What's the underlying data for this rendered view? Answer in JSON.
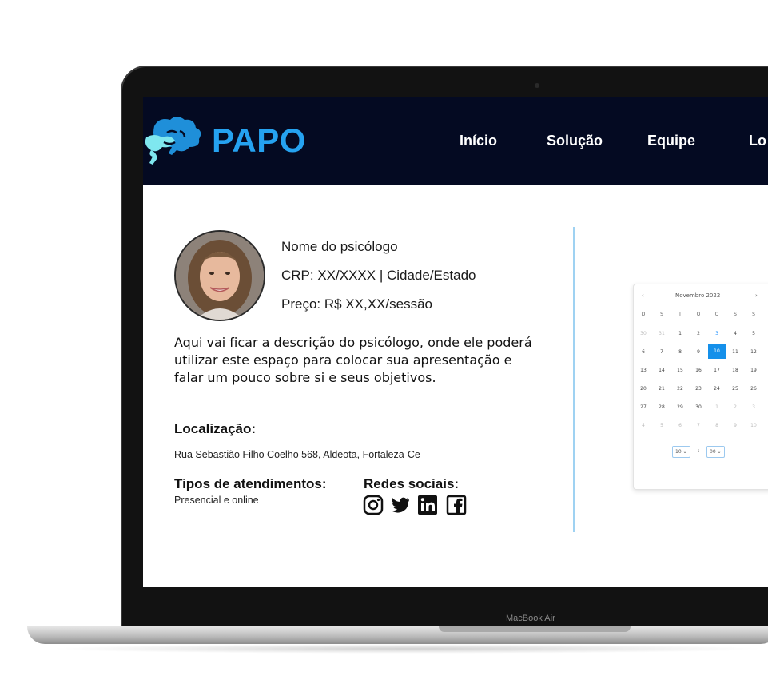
{
  "device": {
    "label": "MacBook Air"
  },
  "nav": {
    "brand": "PAPO",
    "links": [
      "Início",
      "Solução",
      "Equipe",
      "Lo"
    ]
  },
  "profile": {
    "name": "Nome do psicólogo",
    "crp": "CRP: XX/XXXX | Cidade/Estado",
    "price": "Preço: R$ XX,XX/sessão",
    "description": "Aqui vai ficar a descrição do psicólogo, onde ele poderá utilizar este espaço para colocar sua apresentação e falar um pouco sobre si e seus objetivos.",
    "location_label": "Localização:",
    "address": "Rua Sebastião Filho Coelho 568, Aldeota, Fortaleza-Ce",
    "service_types_label": "Tipos de atendimentos:",
    "service_types": "Presencial e online",
    "social_label": "Redes sociais:",
    "social_icons": [
      "instagram-icon",
      "twitter-icon",
      "linkedin-icon",
      "facebook-icon"
    ]
  },
  "calendar": {
    "prev": "‹",
    "month_year": "Novembro 2022",
    "next": "›",
    "weekdays": [
      "D",
      "S",
      "T",
      "Q",
      "Q",
      "S",
      "S"
    ],
    "weeks": [
      [
        "30",
        "31",
        "1",
        "2",
        "3",
        "4",
        "5"
      ],
      [
        "6",
        "7",
        "8",
        "9",
        "10",
        "11",
        "12"
      ],
      [
        "13",
        "14",
        "15",
        "16",
        "17",
        "18",
        "19"
      ],
      [
        "20",
        "21",
        "22",
        "23",
        "24",
        "25",
        "26"
      ],
      [
        "27",
        "28",
        "29",
        "30",
        "1",
        "2",
        "3"
      ],
      [
        "4",
        "5",
        "6",
        "7",
        "8",
        "9",
        "10"
      ]
    ],
    "today": "3",
    "selected": "10",
    "hour": "10 ⌄",
    "separator": ":",
    "minute": "00 ⌄"
  },
  "colors": {
    "nav_bg": "#040a22",
    "brand": "#25a2f0",
    "accent": "#1590ea"
  }
}
